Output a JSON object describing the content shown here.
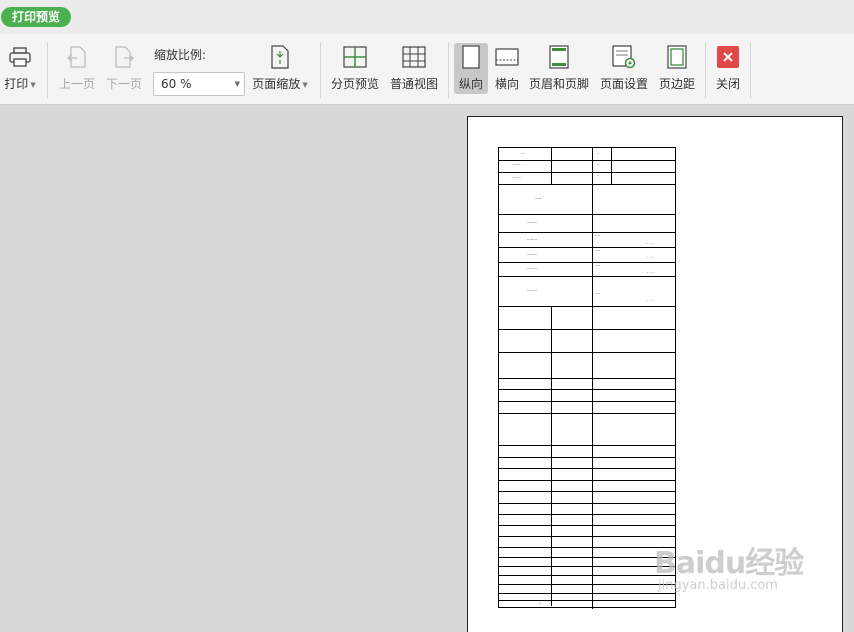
{
  "tab": {
    "label": "打印预览"
  },
  "toolbar": {
    "print": "打印",
    "prev_page": "上一页",
    "next_page": "下一页",
    "zoom_label": "缩放比例:",
    "zoom_value": "60 %",
    "page_zoom": "页面缩放",
    "page_break_preview": "分页预览",
    "normal_view": "普通视图",
    "portrait": "纵向",
    "landscape": "横向",
    "header_footer": "页眉和页脚",
    "page_setup": "页面设置",
    "margins": "页边距",
    "close": "关闭"
  },
  "colors": {
    "accent_green": "#4caf50",
    "close_red": "#e04848",
    "icon_green": "#3c8d3c"
  },
  "watermark": {
    "brand": "Baidu经验",
    "url": "jingyan.baidu.com"
  }
}
